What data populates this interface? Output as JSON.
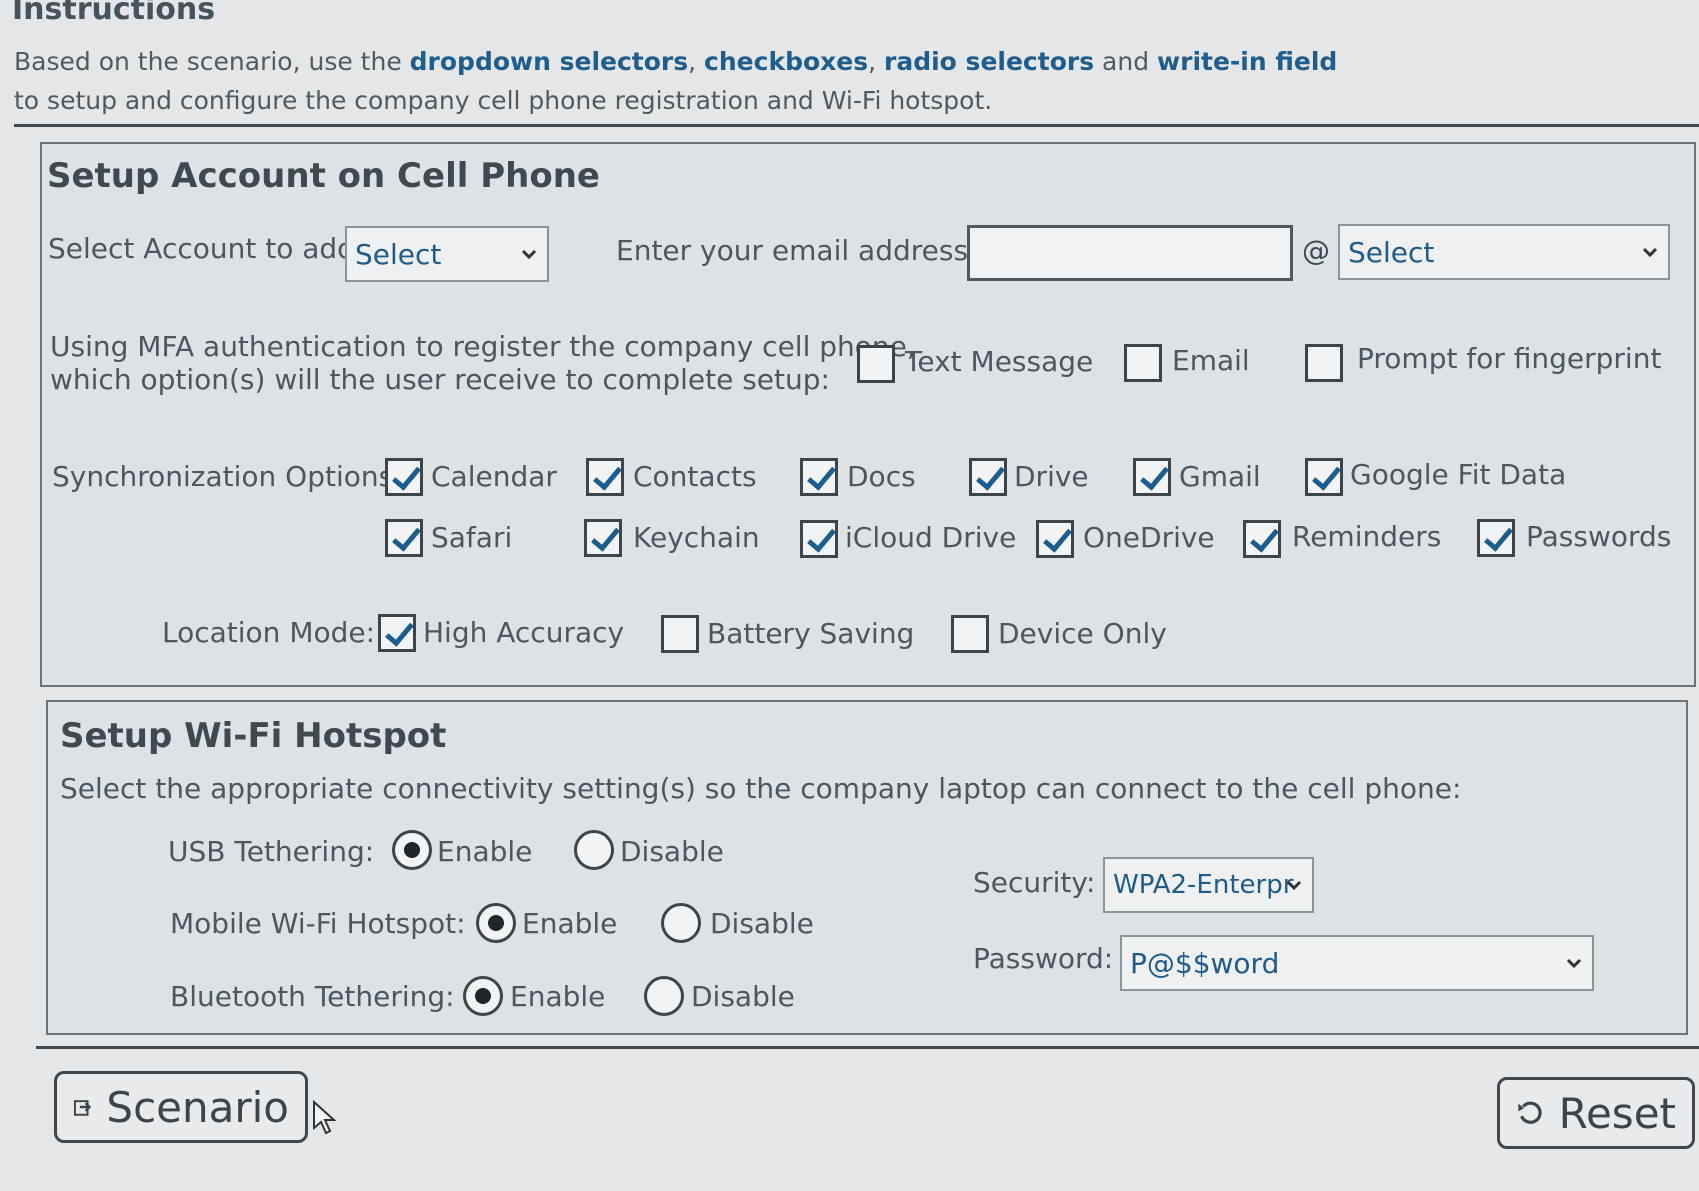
{
  "instructions": {
    "title": "Instructions",
    "text_1": "Based on the scenario, use the ",
    "link_dropdown": "dropdown selectors",
    "sep_1": ", ",
    "link_checkboxes": "checkboxes",
    "sep_2": ", ",
    "link_radio": "radio selectors",
    "text_and": " and ",
    "link_writein": "write-in field",
    "text_2": " to setup and configure the company cell phone registration and Wi-Fi hotspot."
  },
  "account_section": {
    "title": "Setup Account on Cell Phone",
    "account_label": "Select Account to add:",
    "account_select": "Select",
    "email_label": "Enter your email address:",
    "email_value": "",
    "at_symbol": "@",
    "domain_select": "Select",
    "mfa_question_line1": "Using MFA authentication to register the company cell phone,",
    "mfa_question_line2": "which option(s) will the user receive to complete setup:",
    "mfa_options": [
      {
        "label": "Text Message",
        "checked": false
      },
      {
        "label": "Email",
        "checked": false
      },
      {
        "label": "Prompt for fingerprint",
        "checked": false
      }
    ],
    "sync_label": "Synchronization Options:",
    "sync_options": [
      {
        "label": "Calendar",
        "checked": true
      },
      {
        "label": "Contacts",
        "checked": true
      },
      {
        "label": "Docs",
        "checked": true
      },
      {
        "label": "Drive",
        "checked": true
      },
      {
        "label": "Gmail",
        "checked": true
      },
      {
        "label": "Google Fit Data",
        "checked": true
      },
      {
        "label": "Safari",
        "checked": true
      },
      {
        "label": "Keychain",
        "checked": true
      },
      {
        "label": "iCloud Drive",
        "checked": true
      },
      {
        "label": "OneDrive",
        "checked": true
      },
      {
        "label": "Reminders",
        "checked": true
      },
      {
        "label": "Passwords",
        "checked": true
      }
    ],
    "location_label": "Location Mode:",
    "location_options": [
      {
        "label": "High Accuracy",
        "checked": true
      },
      {
        "label": "Battery Saving",
        "checked": false
      },
      {
        "label": "Device Only",
        "checked": false
      }
    ]
  },
  "hotspot_section": {
    "title": "Setup Wi-Fi Hotspot",
    "instruction": "Select the appropriate connectivity setting(s) so the company laptop can connect to the cell phone:",
    "usb_label": "USB Tethering:",
    "usb_selected": "Enable",
    "wifi_label": "Mobile Wi-Fi Hotspot:",
    "wifi_selected": "Enable",
    "bt_label": "Bluetooth Tethering:",
    "bt_selected": "Enable",
    "enable_label": "Enable",
    "disable_label": "Disable",
    "security_label": "Security:",
    "security_value": "WPA2-Enterpr",
    "password_label": "Password:",
    "password_value": "P@$$word"
  },
  "buttons": {
    "scenario": "Scenario",
    "reset": "Reset"
  },
  "colors": {
    "accent": "#1e5d8e",
    "background": "#e4e6e7",
    "panel": "#dfe2e4"
  }
}
